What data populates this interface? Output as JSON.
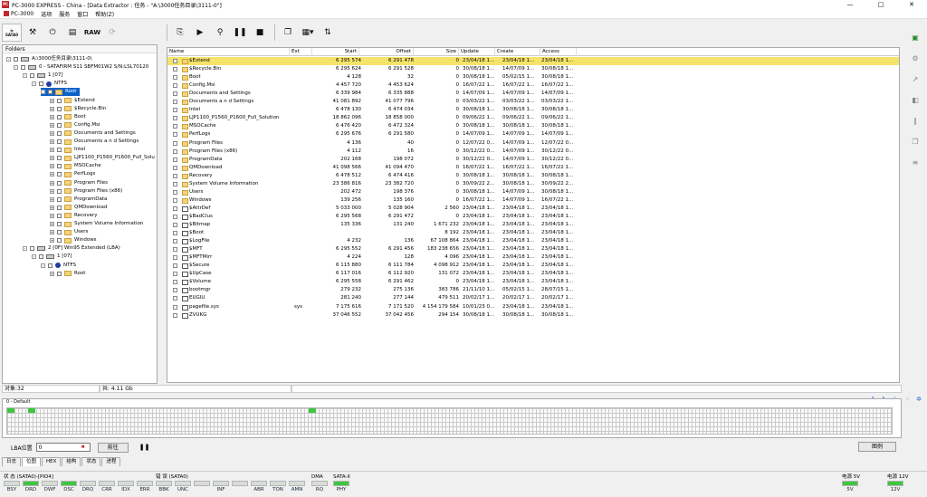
{
  "window": {
    "title": "PC-3000 EXPRESS - China - [Data Extractor : 任务 - \"A:\\3000任务目录\\3111-0\"]",
    "controls": [
      "—",
      "□",
      "✕"
    ]
  },
  "menu": [
    "PC-3000",
    "选项",
    "服务",
    "窗口",
    "帮助(Z)"
  ],
  "toolbar": {
    "sata_label": "SATA0",
    "raw_label": "RAW"
  },
  "folders": {
    "header": "Folders",
    "nodes": [
      {
        "label": "A:\\3000任务目录\\3111-0\\",
        "kind": "hdd",
        "exp": "-"
      },
      {
        "label": "0 - SATAFIRM   S11 SBFM01W2 S/N:LSL70120",
        "kind": "hdd",
        "exp": "-"
      },
      {
        "label": "1 [07]",
        "kind": "hdd",
        "exp": "-"
      },
      {
        "label": "NTFS",
        "kind": "part",
        "exp": "-"
      },
      {
        "label": "Root",
        "kind": "folder",
        "exp": "-",
        "selected": true
      },
      {
        "label": "$Extend",
        "kind": "folder",
        "exp": "+"
      },
      {
        "label": "$Recycle.Bin",
        "kind": "folder",
        "exp": "+"
      },
      {
        "label": "Boot",
        "kind": "folder",
        "exp": "+"
      },
      {
        "label": "Config.Msi",
        "kind": "folder",
        "exp": "+"
      },
      {
        "label": "Documents and Settings",
        "kind": "folder",
        "exp": "+"
      },
      {
        "label": "Documents a n d Settings",
        "kind": "folder",
        "exp": "+"
      },
      {
        "label": "Intel",
        "kind": "folder",
        "exp": "+"
      },
      {
        "label": "LJP1100_P1560_P1600_Full_Solu",
        "kind": "folder",
        "exp": "+"
      },
      {
        "label": "MSOCache",
        "kind": "folder",
        "exp": "+"
      },
      {
        "label": "PerfLogs",
        "kind": "folder",
        "exp": "+"
      },
      {
        "label": "Program Files",
        "kind": "folder",
        "exp": "+"
      },
      {
        "label": "Program Files (x86)",
        "kind": "folder",
        "exp": "+"
      },
      {
        "label": "ProgramData",
        "kind": "folder",
        "exp": "+"
      },
      {
        "label": "QMDownload",
        "kind": "folder",
        "exp": "+"
      },
      {
        "label": "Recovery",
        "kind": "folder",
        "exp": "+"
      },
      {
        "label": "System Volume Information",
        "kind": "folder",
        "exp": "+"
      },
      {
        "label": "Users",
        "kind": "folder",
        "exp": "+"
      },
      {
        "label": "Windows",
        "kind": "folder",
        "exp": "+"
      },
      {
        "label": "2 [0F] Win95 Extended  (LBA)",
        "kind": "hdd",
        "exp": "-"
      },
      {
        "label": "1 [07]",
        "kind": "hdd",
        "exp": "-"
      },
      {
        "label": "NTFS",
        "kind": "part",
        "exp": "-"
      },
      {
        "label": "Root",
        "kind": "folder",
        "exp": "+"
      }
    ]
  },
  "list": {
    "columns": [
      "Name",
      "Ext",
      "Start",
      "Offset",
      "Size",
      "Update",
      "Create",
      "Access"
    ],
    "rows": [
      {
        "name": "$Extend",
        "ext": "",
        "start": "6 295 574",
        "offset": "6 291 478",
        "size": "0",
        "update": "23/04/18 1...",
        "create": "23/04/18 1...",
        "access": "23/04/18 1...",
        "kind": "folder",
        "sel": true
      },
      {
        "name": "$Recycle.Bin",
        "ext": "",
        "start": "6 295 624",
        "offset": "6 291 528",
        "size": "0",
        "update": "30/08/18 1...",
        "create": "14/07/09 1...",
        "access": "30/08/18 1...",
        "kind": "folder"
      },
      {
        "name": "Boot",
        "ext": "",
        "start": "4 128",
        "offset": "32",
        "size": "0",
        "update": "30/08/18 1...",
        "create": "05/02/15 1...",
        "access": "30/08/18 1...",
        "kind": "folder"
      },
      {
        "name": "Config.Msi",
        "ext": "",
        "start": "4 457 720",
        "offset": "4 453 624",
        "size": "0",
        "update": "16/07/22 1...",
        "create": "16/07/22 1...",
        "access": "16/07/22 1...",
        "kind": "folder"
      },
      {
        "name": "Documents and Settings",
        "ext": "",
        "start": "6 339 984",
        "offset": "6 335 888",
        "size": "0",
        "update": "14/07/09 1...",
        "create": "14/07/09 1...",
        "access": "14/07/09 1...",
        "kind": "folder"
      },
      {
        "name": "Documents a n d Settings",
        "ext": "",
        "start": "41 081 892",
        "offset": "41 077 796",
        "size": "0",
        "update": "03/03/22 1...",
        "create": "03/03/22 1...",
        "access": "03/03/22 1...",
        "kind": "folder"
      },
      {
        "name": "Intel",
        "ext": "",
        "start": "6 478 130",
        "offset": "6 474 034",
        "size": "0",
        "update": "30/08/18 1...",
        "create": "30/08/18 1...",
        "access": "30/08/18 1...",
        "kind": "folder"
      },
      {
        "name": "LJP1100_P1560_P1600_Full_Solution",
        "ext": "",
        "start": "18 862 096",
        "offset": "18 858 000",
        "size": "0",
        "update": "09/06/22 1...",
        "create": "09/06/22 1...",
        "access": "09/06/22 1...",
        "kind": "folder"
      },
      {
        "name": "MSOCache",
        "ext": "",
        "start": "6 476 420",
        "offset": "6 472 324",
        "size": "0",
        "update": "30/08/18 1...",
        "create": "30/08/18 1...",
        "access": "30/08/18 1...",
        "kind": "folder"
      },
      {
        "name": "PerfLogs",
        "ext": "",
        "start": "6 295 676",
        "offset": "6 291 580",
        "size": "0",
        "update": "14/07/09 1...",
        "create": "14/07/09 1...",
        "access": "14/07/09 1...",
        "kind": "folder"
      },
      {
        "name": "Program Files",
        "ext": "",
        "start": "4 136",
        "offset": "40",
        "size": "0",
        "update": "12/07/22 0...",
        "create": "14/07/09 1...",
        "access": "12/07/22 0...",
        "kind": "folder"
      },
      {
        "name": "Program Files (x86)",
        "ext": "",
        "start": "4 112",
        "offset": "16",
        "size": "0",
        "update": "30/12/22 0...",
        "create": "14/07/09 1...",
        "access": "30/12/22 0...",
        "kind": "folder"
      },
      {
        "name": "ProgramData",
        "ext": "",
        "start": "202 168",
        "offset": "198 072",
        "size": "0",
        "update": "30/12/22 0...",
        "create": "14/07/09 1...",
        "access": "30/12/22 0...",
        "kind": "folder"
      },
      {
        "name": "QMDownload",
        "ext": "",
        "start": "41 098 566",
        "offset": "41 094 470",
        "size": "0",
        "update": "16/07/22 1...",
        "create": "16/07/22 1...",
        "access": "16/07/22 1...",
        "kind": "folder"
      },
      {
        "name": "Recovery",
        "ext": "",
        "start": "6 478 512",
        "offset": "6 474 416",
        "size": "0",
        "update": "30/08/18 1...",
        "create": "30/08/18 1...",
        "access": "30/08/18 1...",
        "kind": "folder"
      },
      {
        "name": "System Volume Information",
        "ext": "",
        "start": "23 386 816",
        "offset": "23 382 720",
        "size": "0",
        "update": "30/09/22 2...",
        "create": "30/08/18 1...",
        "access": "30/09/22 2...",
        "kind": "folder"
      },
      {
        "name": "Users",
        "ext": "",
        "start": "202 472",
        "offset": "198 376",
        "size": "0",
        "update": "30/08/18 1...",
        "create": "14/07/09 1...",
        "access": "30/08/18 1...",
        "kind": "folder"
      },
      {
        "name": "Windows",
        "ext": "",
        "start": "139 256",
        "offset": "135 160",
        "size": "0",
        "update": "16/07/22 1...",
        "create": "14/07/09 1...",
        "access": "16/07/22 1...",
        "kind": "folder"
      },
      {
        "name": "$AttrDef",
        "ext": "",
        "start": "5 033 000",
        "offset": "5 028 904",
        "size": "2 560",
        "update": "23/04/18 1...",
        "create": "23/04/18 1...",
        "access": "23/04/18 1...",
        "kind": "file"
      },
      {
        "name": "$BadClus",
        "ext": "",
        "start": "6 295 568",
        "offset": "6 291 472",
        "size": "0",
        "update": "23/04/18 1...",
        "create": "23/04/18 1...",
        "access": "23/04/18 1...",
        "kind": "file"
      },
      {
        "name": "$Bitmap",
        "ext": "",
        "start": "135 336",
        "offset": "131 240",
        "size": "1 671 232",
        "update": "23/04/18 1...",
        "create": "23/04/18 1...",
        "access": "23/04/18 1...",
        "kind": "file"
      },
      {
        "name": "$Boot",
        "ext": "",
        "start": "",
        "offset": "",
        "size": "8 192",
        "update": "23/04/18 1...",
        "create": "23/04/18 1...",
        "access": "23/04/18 1...",
        "kind": "file"
      },
      {
        "name": "$LogFile",
        "ext": "",
        "start": "4 232",
        "offset": "136",
        "size": "67 108 864",
        "update": "23/04/18 1...",
        "create": "23/04/18 1...",
        "access": "23/04/18 1...",
        "kind": "file"
      },
      {
        "name": "$MFT",
        "ext": "",
        "start": "6 295 552",
        "offset": "6 291 456",
        "size": "183 238 656",
        "update": "23/04/18 1...",
        "create": "23/04/18 1...",
        "access": "23/04/18 1...",
        "kind": "file"
      },
      {
        "name": "$MFTMirr",
        "ext": "",
        "start": "4 224",
        "offset": "128",
        "size": "4 096",
        "update": "23/04/18 1...",
        "create": "23/04/18 1...",
        "access": "23/04/18 1...",
        "kind": "file"
      },
      {
        "name": "$Secure",
        "ext": "",
        "start": "6 115 880",
        "offset": "6 111 784",
        "size": "4 098 912",
        "update": "23/04/18 1...",
        "create": "23/04/18 1...",
        "access": "23/04/18 1...",
        "kind": "file"
      },
      {
        "name": "$UpCase",
        "ext": "",
        "start": "6 117 016",
        "offset": "6 112 920",
        "size": "131 072",
        "update": "23/04/18 1...",
        "create": "23/04/18 1...",
        "access": "23/04/18 1...",
        "kind": "file"
      },
      {
        "name": "$Volume",
        "ext": "",
        "start": "6 295 558",
        "offset": "6 291 462",
        "size": "0",
        "update": "23/04/18 1...",
        "create": "23/04/18 1...",
        "access": "23/04/18 1...",
        "kind": "file"
      },
      {
        "name": "bootmgr",
        "ext": "",
        "start": "279 232",
        "offset": "275 136",
        "size": "383 786",
        "update": "21/11/10 1...",
        "create": "05/02/15 1...",
        "access": "28/07/15 1...",
        "kind": "file"
      },
      {
        "name": "EUGIU",
        "ext": "",
        "start": "281 240",
        "offset": "277 144",
        "size": "479 511",
        "update": "20/02/17 1...",
        "create": "20/02/17 1...",
        "access": "20/02/17 1...",
        "kind": "file"
      },
      {
        "name": "pagefile.sys",
        "ext": "sys",
        "start": "7 175 616",
        "offset": "7 171 520",
        "size": "4 154 179 584",
        "update": "10/01/23 0...",
        "create": "23/04/18 1...",
        "access": "23/04/18 1...",
        "kind": "file"
      },
      {
        "name": "ZVUKG",
        "ext": "",
        "start": "37 046 552",
        "offset": "37 042 456",
        "size": "294 154",
        "update": "30/08/18 1...",
        "create": "30/08/18 1...",
        "access": "30/08/18 1...",
        "kind": "file"
      }
    ]
  },
  "status": {
    "objects": "对象:32",
    "total": "共: 4.11 Gb"
  },
  "map": {
    "header": "0 - Default",
    "lba_label": "LBA位置",
    "lba_value": "0",
    "goto": "前往",
    "map_button": "图例"
  },
  "tabs": [
    "日志",
    "位图",
    "HEX",
    "结构",
    "状态",
    "进程"
  ],
  "leds": {
    "status_title": "状 态 (SATA0)-[PIO4]",
    "status": [
      {
        "n": "BSY",
        "on": false
      },
      {
        "n": "DRD",
        "on": true
      },
      {
        "n": "DWF",
        "on": false
      },
      {
        "n": "DSC",
        "on": true
      },
      {
        "n": "DRQ",
        "on": false
      },
      {
        "n": "CRR",
        "on": false
      },
      {
        "n": "IDX",
        "on": false
      },
      {
        "n": "ERR",
        "on": false
      }
    ],
    "error_title": "错 误 (SATA0)",
    "error": [
      {
        "n": "BBK",
        "on": false
      },
      {
        "n": "UNC",
        "on": false
      },
      {
        "n": "",
        "on": false
      },
      {
        "n": "INF",
        "on": false
      },
      {
        "n": "",
        "on": false
      },
      {
        "n": "ABR",
        "on": false
      },
      {
        "n": "TON",
        "on": false
      },
      {
        "n": "AMN",
        "on": false
      }
    ],
    "dma_title": "DMA",
    "dma": [
      {
        "n": "RQ",
        "on": false
      }
    ],
    "sata_title": "SATA-II",
    "sata": [
      {
        "n": "PHY",
        "on": true
      }
    ],
    "p5_title": "电源 5V",
    "p5": [
      {
        "n": "5V",
        "on": true
      }
    ],
    "p12_title": "电源 12V",
    "p12": [
      {
        "n": "12V",
        "on": true
      }
    ]
  },
  "grid_marks": [
    0.0,
    0.024,
    0.34
  ]
}
